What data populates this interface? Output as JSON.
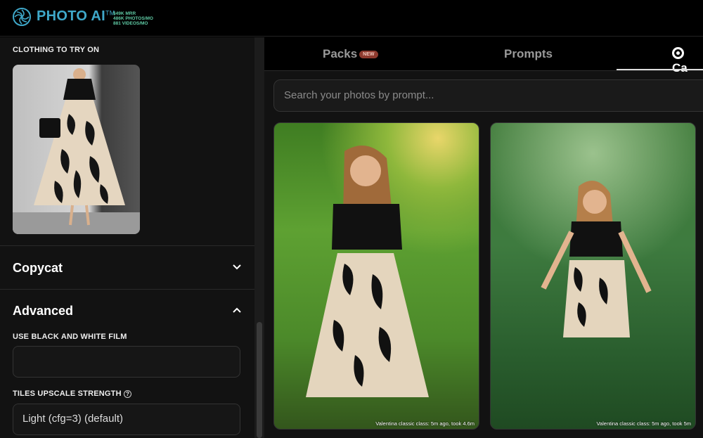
{
  "header": {
    "brand": "PHOTO AI",
    "tm": "TM",
    "stats": [
      "$49K MRR",
      "486K PHOTOS/MO",
      "881 VIDEOS/MO"
    ]
  },
  "sidebar": {
    "clothing_label": "CLOTHING TO TRY ON",
    "copycat": "Copycat",
    "advanced": "Advanced",
    "bw_label": "USE BLACK AND WHITE FILM",
    "bw_value": "",
    "tiles_label": "TILES UPSCALE STRENGTH",
    "tiles_value": "Light (cfg=3) (default)"
  },
  "tabs": [
    {
      "label": "Packs",
      "badge": "NEW"
    },
    {
      "label": "Prompts"
    },
    {
      "label": "Ca"
    }
  ],
  "search": {
    "placeholder": "Search your photos by prompt..."
  },
  "photos": [
    {
      "caption": "Valentina classic class: 5m ago, took 4.6m"
    },
    {
      "caption": "Valentina classic class: 5m ago, took 5m"
    }
  ]
}
